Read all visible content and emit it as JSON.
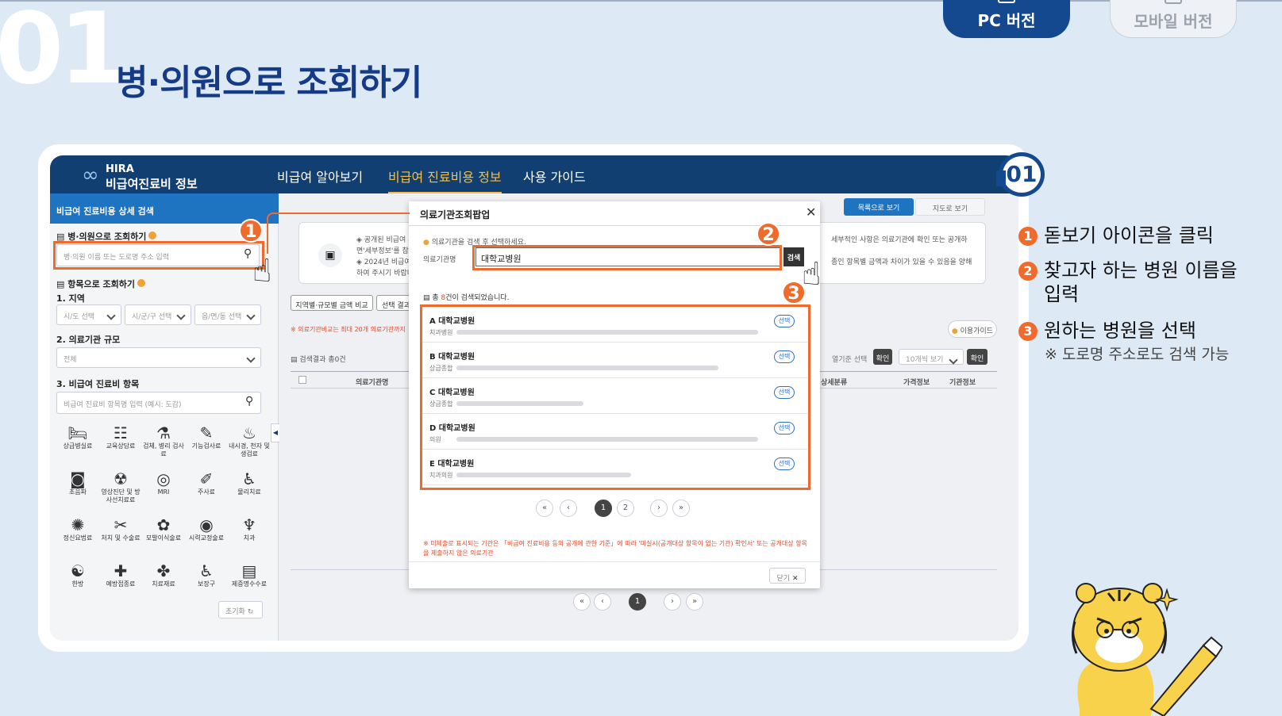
{
  "heading": {
    "number": "01",
    "title": "병·의원으로 조회하기"
  },
  "version_tabs": {
    "pc": "PC 버전",
    "mobile": "모바일 버전"
  },
  "app": {
    "logo_small": "HIRA",
    "logo_name": "비급여진료비 정보",
    "nav": [
      "비급여 알아보기",
      "비급여 진료비용 정보",
      "사용 가이드"
    ],
    "sidebar": {
      "title": "비급여 진료비용 상세 검색",
      "by_hospital_label": "병·의원으로 조회하기",
      "hospital_search_placeholder": "병·의원 이름 또는 도로명 주소 입력",
      "by_item_label": "항목으로 조회하기",
      "region_label": "1. 지역",
      "region_selects": [
        "시/도 선택",
        "시/군/구 선택",
        "읍/면/동 선택"
      ],
      "size_label": "2. 의료기관 규모",
      "size_value": "전체",
      "item_label": "3. 비급여 진료비 항목",
      "item_search_placeholder": "비급여 진료비 항목명 입력 (예시: 도감)",
      "categories": [
        {
          "label": "상급병실료",
          "icon": "bed-icon"
        },
        {
          "label": "교육상담료",
          "icon": "counsel-icon"
        },
        {
          "label": "검체, 병리 검사료",
          "icon": "lab-icon"
        },
        {
          "label": "기능검사료",
          "icon": "function-test-icon"
        },
        {
          "label": "내시경, 천자 및 생검료",
          "icon": "endoscope-icon"
        },
        {
          "label": "초음파",
          "icon": "ultrasound-icon"
        },
        {
          "label": "영상진단 및 방사선치료료",
          "icon": "radiology-icon"
        },
        {
          "label": "MRI",
          "icon": "mri-icon"
        },
        {
          "label": "주사료",
          "icon": "injection-icon"
        },
        {
          "label": "물리치료",
          "icon": "physio-icon"
        },
        {
          "label": "정신요법료",
          "icon": "mental-icon"
        },
        {
          "label": "처치 및 수술료",
          "icon": "surgery-icon"
        },
        {
          "label": "모발이식술료",
          "icon": "hair-icon"
        },
        {
          "label": "시력교정술료",
          "icon": "eye-icon"
        },
        {
          "label": "치과",
          "icon": "tooth-icon"
        },
        {
          "label": "한방",
          "icon": "oriental-icon"
        },
        {
          "label": "예방접종료",
          "icon": "vaccine-icon"
        },
        {
          "label": "치료재료",
          "icon": "material-icon"
        },
        {
          "label": "보장구",
          "icon": "wheelchair-icon"
        },
        {
          "label": "제증명수수료",
          "icon": "certificate-icon"
        }
      ],
      "reset": "초기화"
    },
    "main": {
      "view_list": "목록으로 보기",
      "view_map": "지도로 보기",
      "notice_1": "◈ 공개된 비급여 가",
      "notice_2": "면'세부정보'를 참고",
      "notice_3": "◈ 2024년 비급여 진",
      "notice_4": "하여 주시기 바랍니다",
      "notice_right_1": "세부적인 사항은 의료기관에 확인 또는 공개하",
      "notice_right_2": "종인 항목별 금액과 차이가 있을 수 있음을 양해",
      "compare_button": "지역별·규모별 금액 비교",
      "select_result_button": "선택 결과",
      "compare_note": "※ 의료기관비교는 최대 20개 의료기관까지",
      "guide_button": "이용가이드",
      "result_count": "검색결과 총0건",
      "sort_label": "열기준 선택",
      "confirm": "확인",
      "per_page": "10개씩 보기",
      "confirm2": "확인",
      "col_name": "의료기관명",
      "col_detail": "상세분류",
      "col_price": "가격정보",
      "col_info": "기관정보",
      "page_current": "1"
    },
    "popup": {
      "title": "의료기관조회팝업",
      "hint": "의료기관을 검색 후 선택하세요.",
      "field_label": "의료기관명",
      "query": "대학교병원",
      "search_button": "검색",
      "total_prefix": "총",
      "total_count": "8",
      "total_suffix": "건이 검색되었습니다.",
      "results": [
        {
          "name": "A 대학교병원",
          "type": "치과병원",
          "select": "선택"
        },
        {
          "name": "B 대학교병원",
          "type": "상급종합",
          "select": "선택"
        },
        {
          "name": "C 대학교병원",
          "type": "상급종합",
          "select": "선택"
        },
        {
          "name": "D 대학교병원",
          "type": "의원",
          "select": "선택"
        },
        {
          "name": "E 대학교병원",
          "type": "치과의원",
          "select": "선택"
        }
      ],
      "pages": [
        "1",
        "2"
      ],
      "footnote": "※ 미체출로 표시되는 기관은 「비급여 진료비용 등의 공개에 관한 기준」에 따라 '미실시(공개대상 항목이 없는 기관) 확인서' 또는 공개대상 항목을 제출하지 않은 의료기관",
      "close_button": "닫기"
    }
  },
  "instructions": {
    "badge": "01",
    "steps": [
      {
        "num": "1",
        "text": "돋보기 아이콘을 클릭"
      },
      {
        "num": "2",
        "text": "찾고자 하는 병원 이름을"
      },
      {
        "num": "3",
        "text": "원하는 병원을 선택"
      }
    ],
    "step2_cont": "입력",
    "note": "※ 도로명 주소로도 검색 가능"
  },
  "callouts": [
    "1",
    "2",
    "3"
  ],
  "colors": {
    "accent": "#f06a2b",
    "navy": "#15498f",
    "header": "#123f72",
    "background": "#dde9f5"
  }
}
